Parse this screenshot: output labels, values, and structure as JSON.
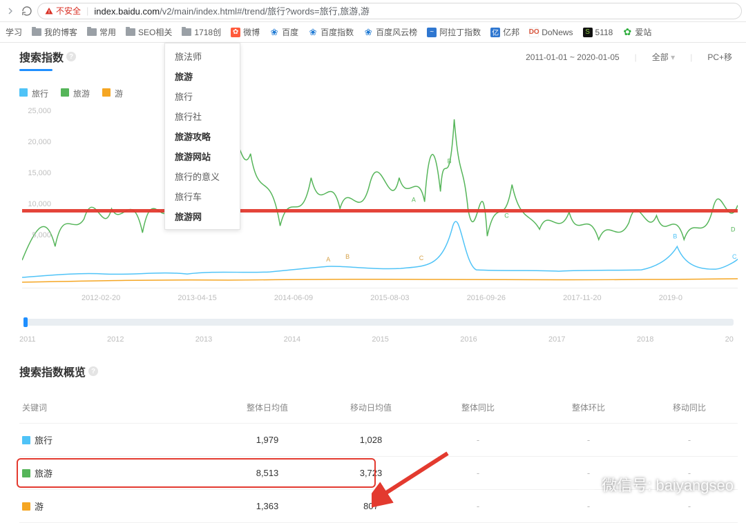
{
  "browser": {
    "insecure_label": "不安全",
    "url_host": "index.baidu.com",
    "url_path": "/v2/main/index.html#/trend/旅行?words=旅行,旅游,游"
  },
  "bookmarks": [
    {
      "label": "学习",
      "type": "text"
    },
    {
      "label": "我的博客",
      "type": "folder"
    },
    {
      "label": "常用",
      "type": "folder"
    },
    {
      "label": "SEO相关",
      "type": "folder"
    },
    {
      "label": "1718创",
      "type": "folder"
    },
    {
      "label": "微博",
      "type": "fav",
      "style": "fav-red",
      "glyph": "✿"
    },
    {
      "label": "百度",
      "type": "fav",
      "style": "fav-dblue",
      "glyph": "❀"
    },
    {
      "label": "百度指数",
      "type": "fav",
      "style": "fav-dblue",
      "glyph": "❀"
    },
    {
      "label": "百度风云榜",
      "type": "fav",
      "style": "fav-dblue",
      "glyph": "❀"
    },
    {
      "label": "阿拉丁指数",
      "type": "fav",
      "style": "fav-blue",
      "glyph": "~"
    },
    {
      "label": "亿邦",
      "type": "fav",
      "style": "fav-blue",
      "glyph": "亿"
    },
    {
      "label": "DoNews",
      "type": "fav",
      "style": "fav-dn",
      "glyph": "DO"
    },
    {
      "label": "5118",
      "type": "fav",
      "style": "fav-dark",
      "glyph": "S"
    },
    {
      "label": "爱站",
      "type": "fav",
      "style": "fav-green",
      "glyph": "✿"
    }
  ],
  "section1": {
    "title": "搜索指数",
    "date_range": "2011-01-01 ~ 2020-01-05",
    "scope": "全部",
    "device": "PC+移"
  },
  "legend": [
    {
      "label": "旅行",
      "color": "c-blue"
    },
    {
      "label": "旅游",
      "color": "c-green"
    },
    {
      "label": "游",
      "color": "c-orange"
    }
  ],
  "dropdown": [
    {
      "label": "旅法师",
      "strong": false
    },
    {
      "label": "旅游",
      "strong": true
    },
    {
      "label": "旅行",
      "strong": false
    },
    {
      "label": "旅行社",
      "strong": false
    },
    {
      "label": "旅游攻略",
      "strong": true
    },
    {
      "label": "旅游网站",
      "strong": true
    },
    {
      "label": "旅行的意义",
      "strong": false
    },
    {
      "label": "旅行车",
      "strong": false
    },
    {
      "label": "旅游网",
      "strong": true
    }
  ],
  "chart_data": {
    "type": "line",
    "ylim": [
      0,
      25000
    ],
    "y_ticks": [
      "25,000",
      "20,000",
      "15,000",
      "10,000",
      "5,000"
    ],
    "x_ticks": [
      "2012-02-20",
      "2013-04-15",
      "2014-06-09",
      "2015-08-03",
      "2016-09-26",
      "2017-11-20",
      "2019-0"
    ],
    "brush_ticks": [
      "2011",
      "2012",
      "2013",
      "2014",
      "2015",
      "2016",
      "2017",
      "2018",
      "20"
    ],
    "annotations": [
      "A",
      "B",
      "C",
      "D"
    ],
    "reference_line_value": 9000,
    "series": [
      {
        "name": "旅行",
        "color": "#4fc3f7"
      },
      {
        "name": "旅游",
        "color": "#55b559"
      },
      {
        "name": "游",
        "color": "#f5a623"
      }
    ]
  },
  "section2": {
    "title": "搜索指数概览",
    "columns": [
      "关键词",
      "整体日均值",
      "移动日均值",
      "整体同比",
      "整体环比",
      "移动同比"
    ],
    "rows": [
      {
        "kw": "旅行",
        "color": "c-blue",
        "v1": "1,979",
        "v2": "1,028",
        "highlight": false
      },
      {
        "kw": "旅游",
        "color": "c-green",
        "v1": "8,513",
        "v2": "3,723",
        "highlight": true
      },
      {
        "kw": "游",
        "color": "c-orange",
        "v1": "1,363",
        "v2": "807",
        "highlight": false
      }
    ]
  },
  "watermark": {
    "text": "微信号: baiyangseo"
  }
}
